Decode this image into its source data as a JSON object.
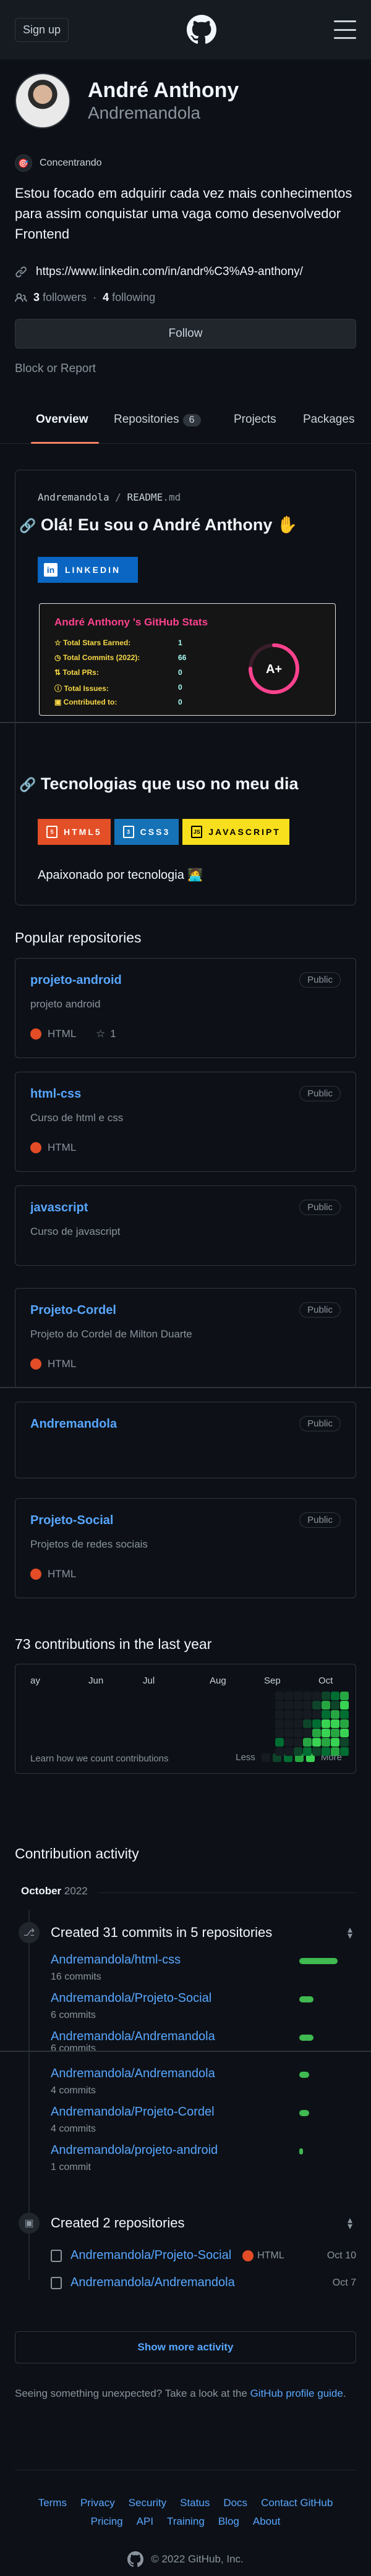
{
  "topbar": {
    "signup_label": "Sign up"
  },
  "profile": {
    "name": "André Anthony",
    "login": "Andremandola",
    "status": "Concentrando",
    "bio": "Estou focado em adquirir cada vez mais conhecimentos para assim conquistar uma vaga como desenvolvedor Frontend",
    "link": "https://www.linkedin.com/in/andr%C3%A9-anthony/",
    "followers_count": "3",
    "followers_label": "followers",
    "following_count": "4",
    "following_label": "following",
    "follow_label": "Follow",
    "block_label": "Block or Report"
  },
  "tabs": [
    {
      "label": "Overview"
    },
    {
      "label": "Repositories",
      "count": "6"
    },
    {
      "label": "Projects"
    },
    {
      "label": "Packages"
    }
  ],
  "readme": {
    "path_user": "Andremandola",
    "path_sep": "/",
    "path_file": "README",
    "path_ext": ".md",
    "heading1": "Olá! Eu sou o André Anthony ✋",
    "linkedin_badge": "LINKEDIN",
    "stats": {
      "title": "André Anthony 's GitHub Stats",
      "rows": [
        {
          "label": "Total Stars Earned:",
          "value": "1"
        },
        {
          "label": "Total Commits (2022):",
          "value": "66"
        },
        {
          "label": "Total PRs:",
          "value": "0"
        },
        {
          "label": "Total Issues:",
          "value": "0"
        },
        {
          "label": "Contributed to:",
          "value": "0"
        }
      ],
      "grade": "A+",
      "grade_fraction": 0.75
    },
    "heading2": "Tecnologias que uso no meu dia",
    "tech_badges": [
      {
        "label": "HTML5",
        "bg": "#e34f26",
        "fg": "#ffffff",
        "icon": "5"
      },
      {
        "label": "CSS3",
        "bg": "#1572b6",
        "fg": "#ffffff",
        "icon": "3"
      },
      {
        "label": "JAVASCRIPT",
        "bg": "#f7df1e",
        "fg": "#000000",
        "icon": "JS"
      }
    ],
    "tagline": "Apaixonado por tecnologia 🧑‍💻"
  },
  "popular": {
    "title": "Popular repositories",
    "repos": [
      {
        "name": "projeto-android",
        "desc": "projeto android",
        "visibility": "Public",
        "lang": "HTML",
        "stars": "1"
      },
      {
        "name": "html-css",
        "desc": "Curso de html e css",
        "visibility": "Public",
        "lang": "HTML"
      },
      {
        "name": "javascript",
        "desc": "Curso de javascript",
        "visibility": "Public"
      },
      {
        "name": "Projeto-Cordel",
        "desc": "Projeto do Cordel de Milton Duarte",
        "visibility": "Public",
        "lang": "HTML"
      },
      {
        "name": "Andremandola",
        "desc": "",
        "visibility": "Public"
      },
      {
        "name": "Projeto-Social",
        "desc": "Projetos de redes sociais",
        "visibility": "Public",
        "lang": "HTML"
      }
    ]
  },
  "contributions": {
    "title": "73 contributions in the last year",
    "months": [
      "ay",
      "Jun",
      "Jul",
      "Aug",
      "Sep",
      "Oct"
    ],
    "learn_label": "Learn how we count contributions",
    "less_label": "Less",
    "more_label": "More",
    "colors": [
      "#161b22",
      "#0e4429",
      "#006d32",
      "#26a641",
      "#39d353"
    ]
  },
  "activity": {
    "title": "Contribution activity",
    "month": "October",
    "year": "2022",
    "commits_head": "Created 31 commits in 5 repositories",
    "commits": [
      {
        "repo": "Andremandola/html-css",
        "count": "16 commits",
        "fraction": 1.0
      },
      {
        "repo": "Andremandola/Projeto-Social",
        "count": "6 commits",
        "fraction": 0.375
      },
      {
        "repo": "Andremandola/Andremandola",
        "count": "6 commits",
        "fraction": 0.375
      },
      {
        "repo": "Andremandola/Andremandola",
        "count": "4 commits",
        "fraction": 0.25
      },
      {
        "repo": "Andremandola/Projeto-Cordel",
        "count": "4 commits",
        "fraction": 0.25
      },
      {
        "repo": "Andremandola/projeto-android",
        "count": "1 commit",
        "fraction": 0.0625
      }
    ],
    "created_head": "Created 2 repositories",
    "created": [
      {
        "repo": "Andremandola/Projeto-Social",
        "lang": "HTML",
        "date": "Oct 10"
      },
      {
        "repo": "Andremandola/Andremandola",
        "lang": "",
        "date": "Oct 7"
      }
    ],
    "show_more": "Show more activity"
  },
  "hint": {
    "text": "Seeing something unexpected? Take a look at the",
    "link": "GitHub profile guide",
    "end": "."
  },
  "footer": {
    "row1": [
      "Terms",
      "Privacy",
      "Security",
      "Status",
      "Docs",
      "Contact GitHub"
    ],
    "row2": [
      "Pricing",
      "API",
      "Training",
      "Blog",
      "About"
    ],
    "copyright": "© 2022 GitHub, Inc."
  }
}
